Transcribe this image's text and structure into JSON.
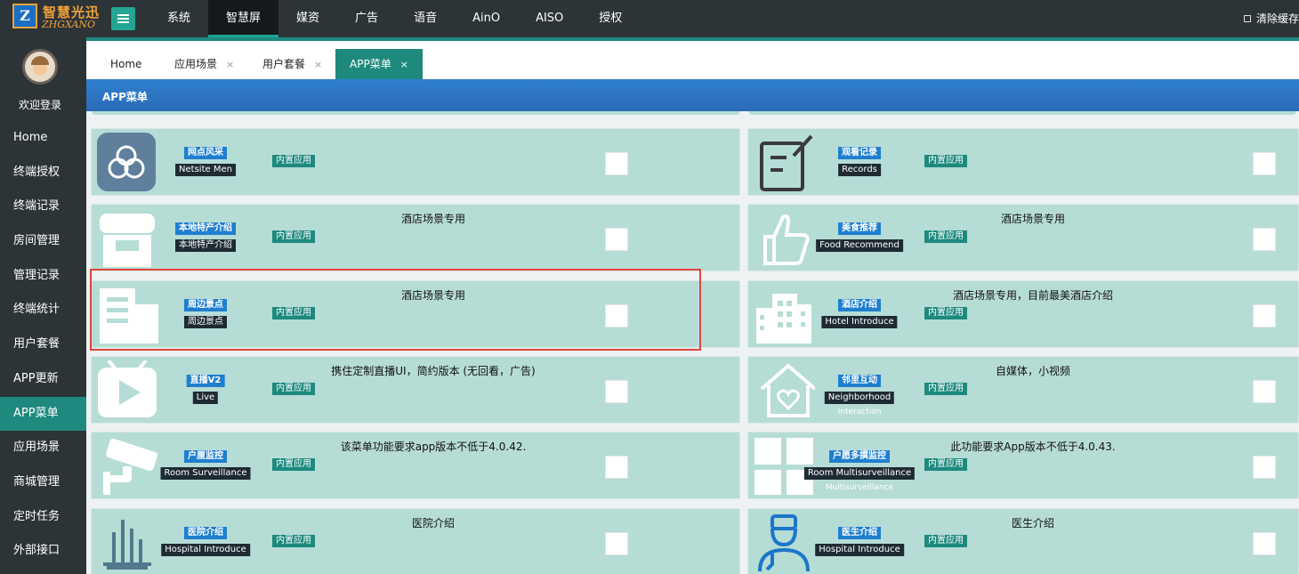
{
  "brand": {
    "cn": "智慧光迅",
    "en": "ZHGXANO",
    "badge": "Z"
  },
  "topnav": [
    "系统",
    "智慧屏",
    "媒资",
    "广告",
    "语音",
    "AinO",
    "AISO",
    "授权"
  ],
  "topnav_active": "智慧屏",
  "clear_cache": "清除缓存",
  "user": {
    "welcome": "欢迎登录"
  },
  "sidebar": [
    "Home",
    "终端授权",
    "终端记录",
    "房间管理",
    "管理记录",
    "终端统计",
    "用户套餐",
    "APP更新",
    "APP菜单",
    "应用场景",
    "商城管理",
    "定时任务",
    "外部接口"
  ],
  "sidebar_active": "APP菜单",
  "tabs": [
    {
      "label": "Home",
      "closable": false
    },
    {
      "label": "应用场景",
      "closable": true
    },
    {
      "label": "用户套餐",
      "closable": true
    },
    {
      "label": "APP菜单",
      "closable": true,
      "active": true
    }
  ],
  "section_title": "APP菜单",
  "builtin_label": "内置应用",
  "cards": [
    {
      "icon": "flower-icon",
      "name_cn": "网点风采",
      "name_en": "Netsite Men",
      "note": ""
    },
    {
      "icon": "notes-icon",
      "name_cn": "观看记录",
      "name_en": "Records",
      "note": ""
    },
    {
      "icon": "store-icon",
      "name_cn": "本地特产介绍",
      "name_en": "本地特产介绍",
      "note": "酒店场景专用"
    },
    {
      "icon": "thumbs-up-icon",
      "name_cn": "美食推荐",
      "name_en": "Food Recommend",
      "note": "酒店场景专用"
    },
    {
      "icon": "building-icon",
      "name_cn": "周边景点",
      "name_en": "周边景点",
      "note": "酒店场景专用"
    },
    {
      "icon": "hotel-icon",
      "name_cn": "酒店介绍",
      "name_en": "Hotel Introduce",
      "note": "酒店场景专用，目前最美酒店介绍"
    },
    {
      "icon": "play-icon",
      "name_cn": "直播V2",
      "name_en": "Live",
      "note": "携住定制直播UI，简约版本 (无回看，广告)"
    },
    {
      "icon": "home-heart-icon",
      "name_cn": "邻里互动",
      "name_en": "Neighborhood",
      "name_en2": "Interaction",
      "note": "自媒体，小视频"
    },
    {
      "icon": "camera-icon",
      "name_cn": "户厘监控",
      "name_en": "Room Surveillance",
      "note": "该菜单功能要求app版本不低于4.0.42."
    },
    {
      "icon": "grid-icon",
      "name_cn": "户愿多撰监控",
      "name_en": "Room Multisurveillance",
      "name_en2": "Multisurveillance",
      "note": "此功能要求App版本不低于4.0.43."
    },
    {
      "icon": "hospital-icon",
      "name_cn": "医院介绍",
      "name_en": "Hospital Introduce",
      "note": "医院介绍"
    },
    {
      "icon": "doctor-icon",
      "name_cn": "医生介绍",
      "name_en": "Hospital Introduce",
      "note": "医生介绍"
    }
  ]
}
